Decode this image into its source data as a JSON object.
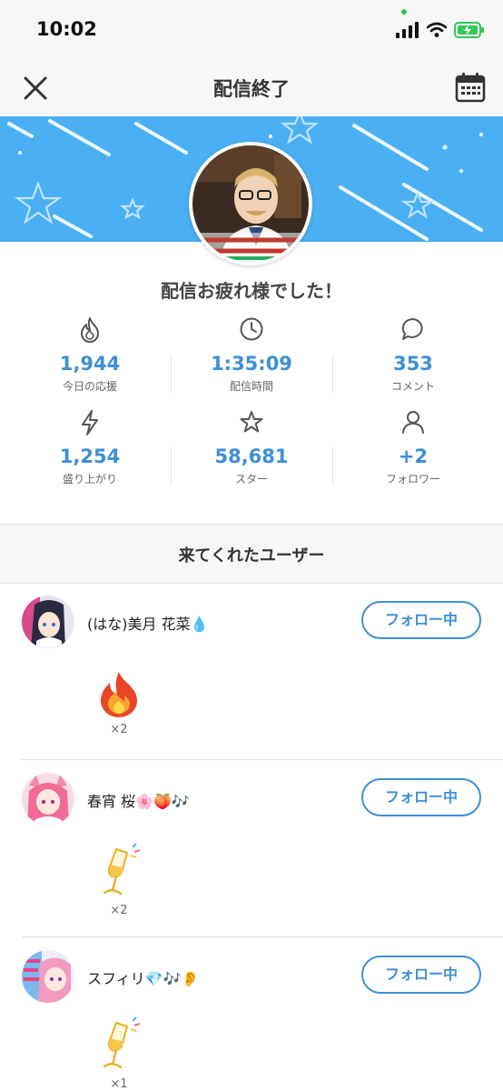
{
  "status_bar": {
    "time": "10:02"
  },
  "nav": {
    "title": "配信終了",
    "close_icon": "close-icon",
    "calendar_icon": "calendar-icon"
  },
  "banner": {
    "color": "#4ab0f3"
  },
  "headline": "配信お疲れ様でした！",
  "stats": [
    {
      "icon": "flame-icon",
      "value": "1,944",
      "label": "今日の応援"
    },
    {
      "icon": "clock-icon",
      "value": "1:35:09",
      "label": "配信時間"
    },
    {
      "icon": "comment-icon",
      "value": "353",
      "label": "コメント"
    },
    {
      "icon": "lightning-icon",
      "value": "1,254",
      "label": "盛り上がり"
    },
    {
      "icon": "star-icon",
      "value": "58,681",
      "label": "スター"
    },
    {
      "icon": "person-icon",
      "value": "+2",
      "label": "フォロワー"
    }
  ],
  "accent_color": "#3d8fd8",
  "section_title": "来てくれたユーザー",
  "users": [
    {
      "name": "(はな)美月 花菜💧",
      "follow_label": "フォロー中",
      "gift_icon": "fire-gift-icon",
      "gift_count": "×2"
    },
    {
      "name": "春宵 桜🌸🍑🎶",
      "follow_label": "フォロー中",
      "gift_icon": "champagne-gift-icon",
      "gift_count": "×2"
    },
    {
      "name": "スフィリ💎🎶👂",
      "follow_label": "フォロー中",
      "gift_icon": "champagne-gift-icon",
      "gift_count": "×1"
    }
  ]
}
